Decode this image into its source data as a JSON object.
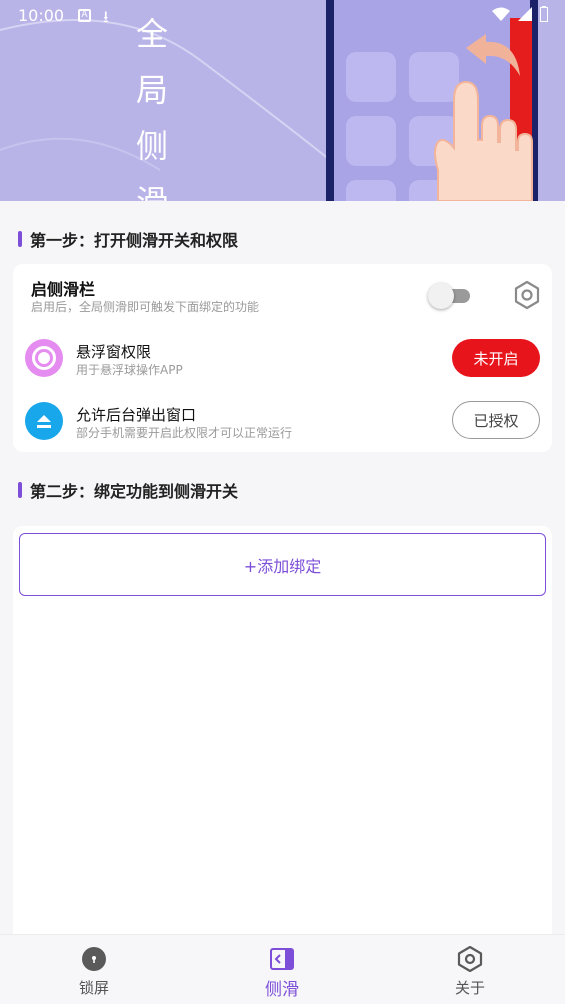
{
  "status_bar": {
    "time": "10:00"
  },
  "banner": {
    "title_chars": [
      "全",
      "局",
      "侧",
      "滑"
    ]
  },
  "step1": {
    "title": "第一步：打开侧滑开关和权限",
    "sidebar_toggle": {
      "title": "启侧滑栏",
      "subtitle": "启用后，全局侧滑即可触发下面绑定的功能",
      "enabled": false
    },
    "overlay_permission": {
      "title": "悬浮窗权限",
      "subtitle": "用于悬浮球操作APP",
      "button": "未开启"
    },
    "background_popup": {
      "title": "允许后台弹出窗口",
      "subtitle": "部分手机需要开启此权限才可以正常运行",
      "button": "已授权"
    }
  },
  "step2": {
    "title": "第二步：绑定功能到侧滑开关",
    "add_button": "+添加绑定"
  },
  "bottom_nav": {
    "items": [
      {
        "label": "锁屏",
        "icon": "lock-icon"
      },
      {
        "label": "侧滑",
        "icon": "side-swipe-icon",
        "active": true
      },
      {
        "label": "关于",
        "icon": "hexagon-settings-icon"
      }
    ]
  },
  "colors": {
    "accent": "#7d4fd8",
    "danger": "#e8141c",
    "banner": "#b9b4e8"
  }
}
